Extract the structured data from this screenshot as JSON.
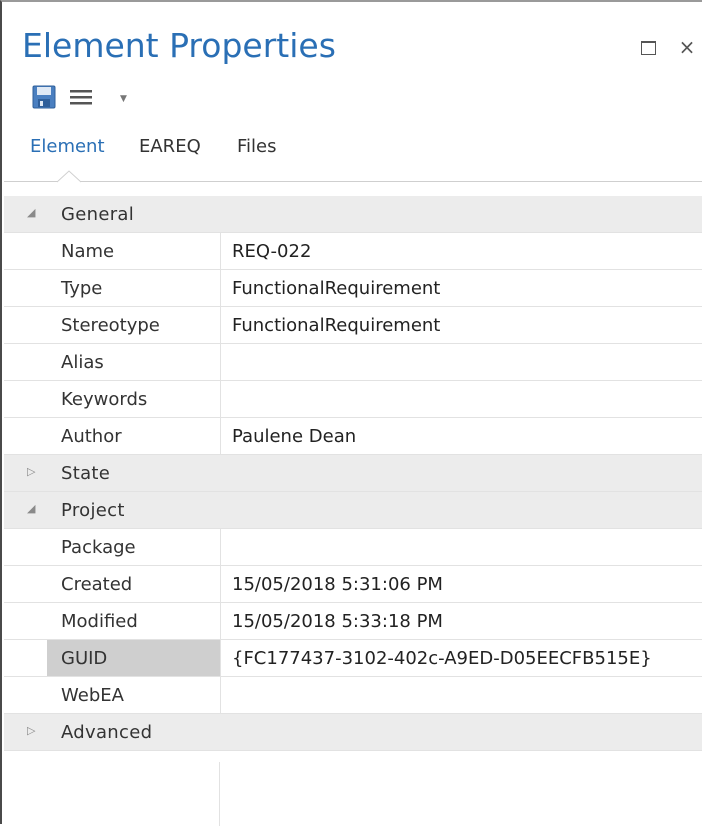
{
  "window": {
    "title": "Element Properties",
    "maximize_icon": "maximize-icon",
    "close_icon": "close-icon",
    "close_glyph": "×"
  },
  "toolbar": {
    "save_icon": "save-icon",
    "menu_icon": "menu-icon",
    "dropdown_icon": "chevron-down-icon"
  },
  "tabs": [
    {
      "label": "Element",
      "active": true
    },
    {
      "label": "EAREQ",
      "active": false
    },
    {
      "label": "Files",
      "active": false
    }
  ],
  "groups": {
    "general": {
      "label": "General",
      "expanded": true,
      "properties": [
        {
          "name": "Name",
          "value": "REQ-022"
        },
        {
          "name": "Type",
          "value": "FunctionalRequirement"
        },
        {
          "name": "Stereotype",
          "value": "FunctionalRequirement"
        },
        {
          "name": "Alias",
          "value": ""
        },
        {
          "name": "Keywords",
          "value": ""
        },
        {
          "name": "Author",
          "value": "Paulene Dean"
        }
      ]
    },
    "state": {
      "label": "State",
      "expanded": false
    },
    "project": {
      "label": "Project",
      "expanded": true,
      "properties": [
        {
          "name": "Package",
          "value": ""
        },
        {
          "name": "Created",
          "value": "15/05/2018 5:31:06 PM"
        },
        {
          "name": "Modified",
          "value": "15/05/2018 5:33:18 PM"
        },
        {
          "name": "GUID",
          "value": "{FC177437-3102-402c-A9ED-D05EECFB515E}",
          "selected": true
        },
        {
          "name": "WebEA",
          "value": ""
        }
      ]
    },
    "advanced": {
      "label": "Advanced",
      "expanded": false
    }
  },
  "glyphs": {
    "expanded": "◢",
    "collapsed": "▷"
  },
  "colors": {
    "title": "#2a6fb5",
    "active_tab": "#2a6fb5",
    "group_background": "#ececec",
    "selected_cell": "#cfcfcf"
  }
}
